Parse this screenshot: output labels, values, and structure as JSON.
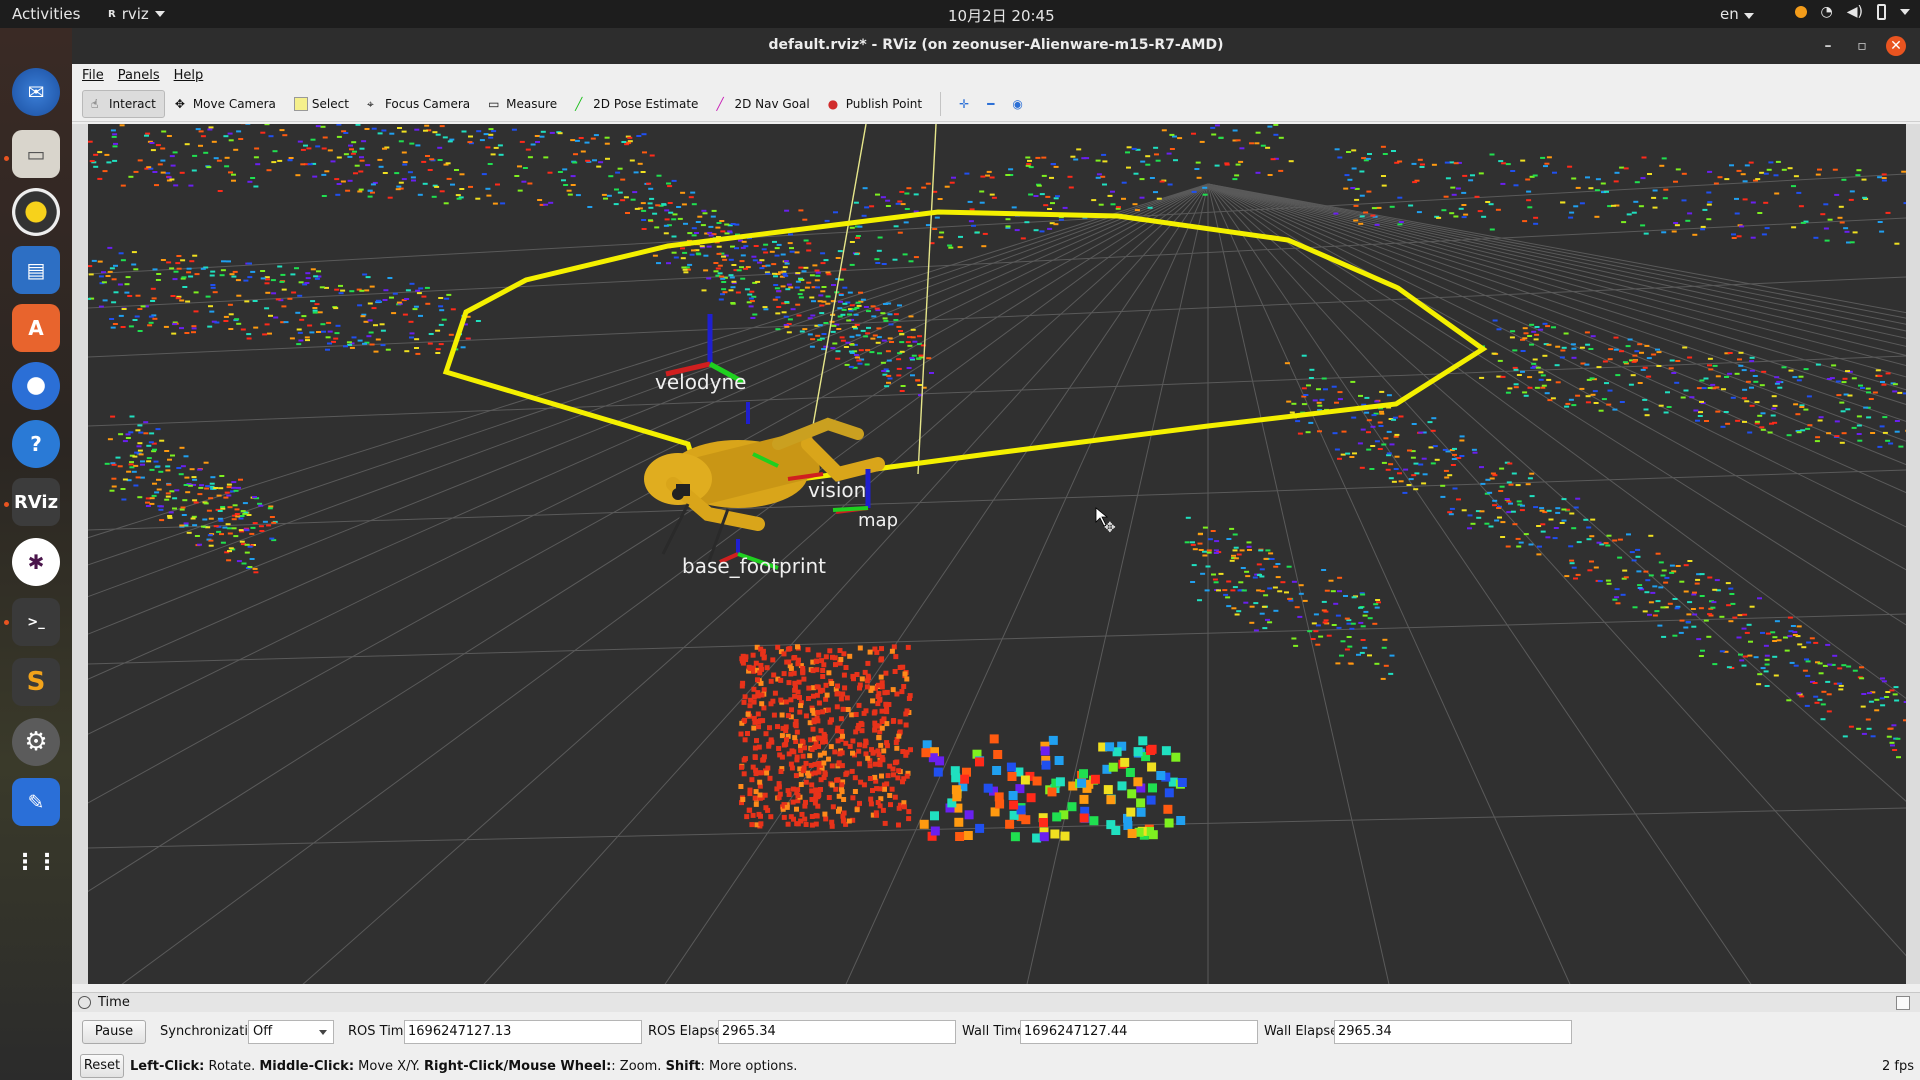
{
  "topbar": {
    "activities": "Activities",
    "app_name": "rviz",
    "clock": "10月2日 20:45",
    "lang": "en"
  },
  "window": {
    "title": "default.rviz* - RViz (on zeonuser-Alienware-m15-R7-AMD)"
  },
  "menu": {
    "file": "File",
    "panels": "Panels",
    "help": "Help"
  },
  "toolbar": {
    "interact": "Interact",
    "move_camera": "Move Camera",
    "select": "Select",
    "focus_camera": "Focus Camera",
    "measure": "Measure",
    "pose_estimate": "2D Pose Estimate",
    "nav_goal": "2D Nav Goal",
    "publish_point": "Publish Point"
  },
  "view_labels": {
    "velodyne": "velodyne",
    "vision": "vision",
    "map": "map",
    "base_footprint": "base_footprint"
  },
  "time_panel": {
    "title": "Time",
    "pause": "Pause",
    "sync_label": "Synchronization:",
    "sync_value": "Off",
    "ros_time_label": "ROS Time:",
    "ros_time": "1696247127.13",
    "ros_elapsed_label": "ROS Elapsed:",
    "ros_elapsed": "2965.34",
    "wall_time_label": "Wall Time:",
    "wall_time": "1696247127.44",
    "wall_elapsed_label": "Wall Elapsed:",
    "wall_elapsed": "2965.34"
  },
  "status": {
    "reset": "Reset",
    "hint_left_click": "Left-Click:",
    "hint_left_action": " Rotate. ",
    "hint_middle_click": "Middle-Click:",
    "hint_middle_action": " Move X/Y. ",
    "hint_right_click": "Right-Click/Mouse Wheel:",
    "hint_right_action": ": Zoom. ",
    "hint_shift": "Shift",
    "hint_shift_action": ": More options.",
    "fps": "2 fps"
  },
  "colors": {
    "background": "#303030",
    "grid": "#5e5e5e",
    "polygon": "#f4f000",
    "robot": "#d9a51a",
    "accent": "#e95420"
  }
}
